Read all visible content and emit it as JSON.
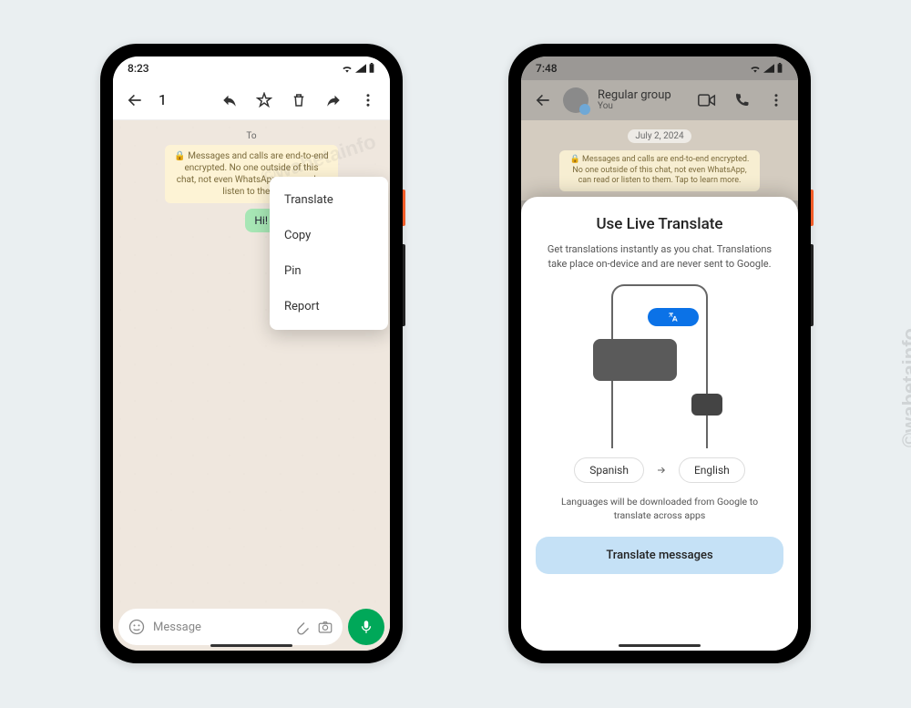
{
  "watermark": "©wabetainfo",
  "phone1": {
    "time": "8:23",
    "selected_count": "1",
    "date_chip": "To",
    "encryption_notice": "🔒 Messages and calls are end-to-end encrypted. No one outside of this chat, not even WhatsApp, can read or listen to them.",
    "message": "Hi! How are things going",
    "menu": {
      "translate": "Translate",
      "copy": "Copy",
      "pin": "Pin",
      "report": "Report"
    },
    "input_placeholder": "Message"
  },
  "phone2": {
    "time": "7:48",
    "chat_title": "Regular group",
    "chat_subtitle": "You",
    "date": "July 2, 2024",
    "encryption_notice": "🔒 Messages and calls are end-to-end encrypted. No one outside of this chat, not even WhatsApp, can read or listen to them. Tap to learn more.",
    "sheet": {
      "title": "Use Live Translate",
      "description": "Get translations instantly as you chat. Translations take place on-device and are never sent to Google.",
      "lang_from": "Spanish",
      "lang_to": "English",
      "note": "Languages will be downloaded from Google to translate across apps",
      "button": "Translate messages"
    }
  }
}
